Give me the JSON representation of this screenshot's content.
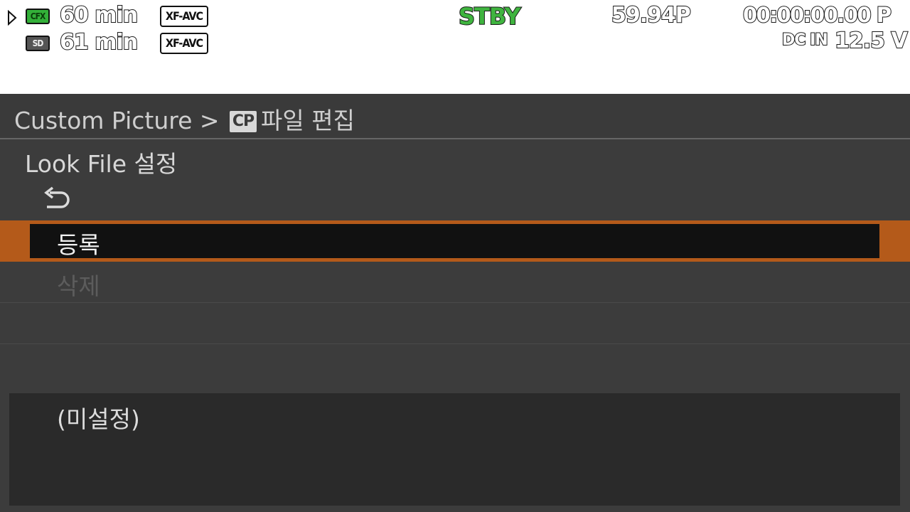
{
  "status_bar": {
    "slot_a": {
      "badge": "CFX",
      "time": "60 min",
      "codec": "XF-AVC"
    },
    "slot_b": {
      "badge": "SD",
      "time": "61 min",
      "codec": "XF-AVC"
    },
    "record_status": "STBY",
    "frame_rate": "59.94P",
    "timecode": "00:00:00.00 P",
    "power_source": "DC IN",
    "voltage": "12.5 V"
  },
  "menu": {
    "breadcrumb_prefix": "Custom Picture >",
    "breadcrumb_icon": "CP",
    "breadcrumb_suffix": "파일 편집",
    "section_title": "Look File 설정",
    "items": [
      {
        "label": "등록",
        "state": "selected"
      },
      {
        "label": "삭제",
        "state": "disabled"
      }
    ],
    "info_text": "(미설정)"
  },
  "colors": {
    "selection_accent": "#b45a1a",
    "status_green": "#3fb43f",
    "menu_bg": "#3c3c3c"
  },
  "icons": [
    "play-triangle-icon",
    "back-arrow-icon"
  ]
}
